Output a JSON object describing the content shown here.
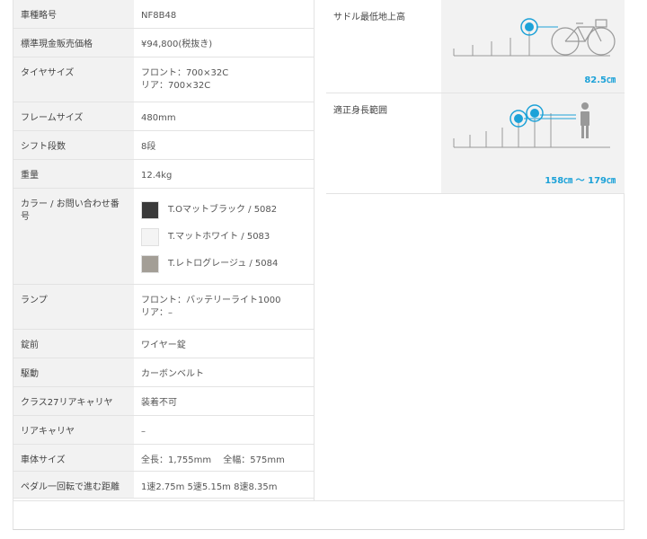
{
  "specs": [
    {
      "label": "車種略号",
      "value": "NF8B48"
    },
    {
      "label": "標準現金販売価格",
      "value": "¥94,800(税抜き)"
    },
    {
      "label": "タイヤサイズ",
      "value1": "フロント：700×32C",
      "value2": "リア：700×32C"
    },
    {
      "label": "フレームサイズ",
      "value": "480mm"
    },
    {
      "label": "シフト段数",
      "value": "8段"
    },
    {
      "label": "重量",
      "value": "12.4kg"
    },
    {
      "label": "カラー / お問い合わせ番号"
    },
    {
      "label": "ランプ",
      "value1": "フロント：バッテリーライト1000",
      "value2": "リア：–"
    },
    {
      "label": "錠前",
      "value": "ワイヤー錠"
    },
    {
      "label": "駆動",
      "value": "カーボンベルト"
    },
    {
      "label": "クラス27リアキャリヤ",
      "value": "装着不可"
    },
    {
      "label": "リアキャリヤ",
      "value": "–"
    },
    {
      "label": "車体サイズ",
      "value": "全長：1,755mm　 全幅：575mm"
    },
    {
      "label": "ペダル一回転で進む距離",
      "value": "1速2.75m 5速5.15m 8速8.35m"
    }
  ],
  "colors": [
    {
      "name": "T.Oマットブラック / 5082",
      "hex": "#3a3a3a"
    },
    {
      "name": "T.マットホワイト / 5083",
      "hex": "#f4f4f4"
    },
    {
      "name": "T.レトログレージュ / 5084",
      "hex": "#a39e96"
    }
  ],
  "saddle": {
    "label": "サドル最低地上高",
    "value": "82.5㎝"
  },
  "height_range": {
    "label": "適正身長範囲",
    "value": "158㎝ ～ 179㎝"
  },
  "accent": "#1da2d8"
}
